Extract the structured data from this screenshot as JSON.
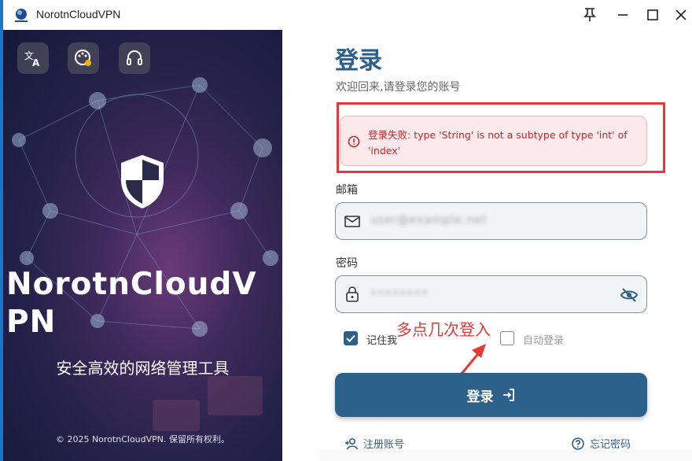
{
  "window": {
    "title": "NorotnCloudVPN"
  },
  "titlebar_buttons": {
    "pin_icon": "pin-icon",
    "minimize_icon": "minimize-icon",
    "maximize_icon": "maximize-icon",
    "close_icon": "close-icon"
  },
  "hero": {
    "toolbar_icons": [
      "translate-icon",
      "palette-icon",
      "headset-icon"
    ],
    "logo_icon": "shield-icon",
    "title": "NorotnCloudVPN",
    "subtitle": "安全高效的网络管理工具",
    "copyright": "© 2025 NorotnCloudVPN. 保留所有权利。"
  },
  "form": {
    "title": "登录",
    "welcome": "欢迎回来,请登录您的账号",
    "error_message": "登录失败: type 'String' is not a subtype of type 'int' of 'index'",
    "email": {
      "label": "邮箱",
      "value": "user@example.net",
      "icon": "mail-icon"
    },
    "password": {
      "label": "密码",
      "value": "••••••••",
      "icon": "lock-icon",
      "toggle_icon": "eye-off-icon"
    },
    "remember_me": {
      "label": "记住我",
      "checked": true
    },
    "auto_login": {
      "label": "自动登录",
      "checked": false
    },
    "login_button": "登录",
    "register_link": "注册账号",
    "forgot_link": "忘记密码"
  },
  "annotation": {
    "text": "多点几次登入",
    "color": "#e53935"
  },
  "colors": {
    "accent": "#2e6189",
    "error": "#c62828",
    "error_bg": "#fbe9eb"
  }
}
